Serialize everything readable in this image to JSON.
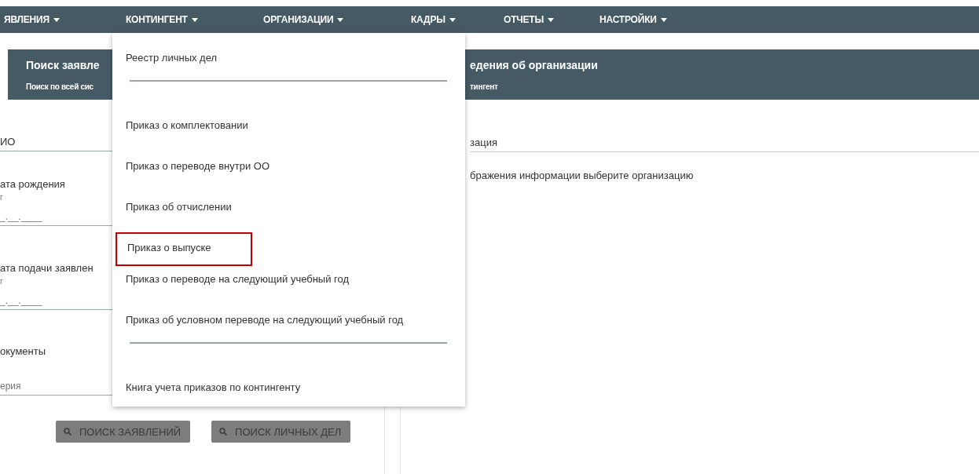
{
  "nav": [
    {
      "label": "ЯВЛЕНИЯ"
    },
    {
      "label": "КОНТИНГЕНТ"
    },
    {
      "label": "ОРГАНИЗАЦИИ"
    },
    {
      "label": "КАДРЫ"
    },
    {
      "label": "ОТЧЕТЫ"
    },
    {
      "label": "НАСТРОЙКИ"
    }
  ],
  "left_panel": {
    "title": "Поиск заявле",
    "subtitle": "Поиск по всей сис",
    "fields": [
      {
        "kind": "text",
        "label": "ИО"
      },
      {
        "kind": "date",
        "label": "ата рождения",
        "hint": "г",
        "value": "_.__.____"
      },
      {
        "kind": "date",
        "label": "ата подачи заявлен",
        "hint": "г",
        "value": "_.__.____"
      }
    ],
    "documents": {
      "label": "окументы",
      "series_placeholder": "ерия"
    },
    "buttons": [
      "ПОИСК ЗАЯВЛЕНИЙ",
      "ПОИСК ЛИЧНЫХ ДЕЛ"
    ]
  },
  "right_panel": {
    "title": "едения об организации",
    "subtitle": "тингент",
    "field_label": "зация",
    "message": "бражения информации выберите организацию"
  },
  "dropdown": [
    {
      "kind": "item",
      "label": "Реестр личных дел",
      "highlighted": false
    },
    {
      "kind": "divider"
    },
    {
      "kind": "item",
      "label": "Приказ о комплектовании",
      "highlighted": false
    },
    {
      "kind": "item",
      "label": "Приказ о переводе внутри ОО",
      "highlighted": false
    },
    {
      "kind": "item",
      "label": "Приказ об отчислении",
      "highlighted": false
    },
    {
      "kind": "item",
      "label": "Приказ о выпуске",
      "highlighted": true
    },
    {
      "kind": "item",
      "label": "Приказ о переводе на следующий учебный год",
      "highlighted": false
    },
    {
      "kind": "item",
      "label": "Приказ об условном переводе на следующий учебный год",
      "highlighted": false
    },
    {
      "kind": "divider"
    },
    {
      "kind": "item",
      "label": "Книга учета приказов по контингенту",
      "highlighted": false
    }
  ]
}
